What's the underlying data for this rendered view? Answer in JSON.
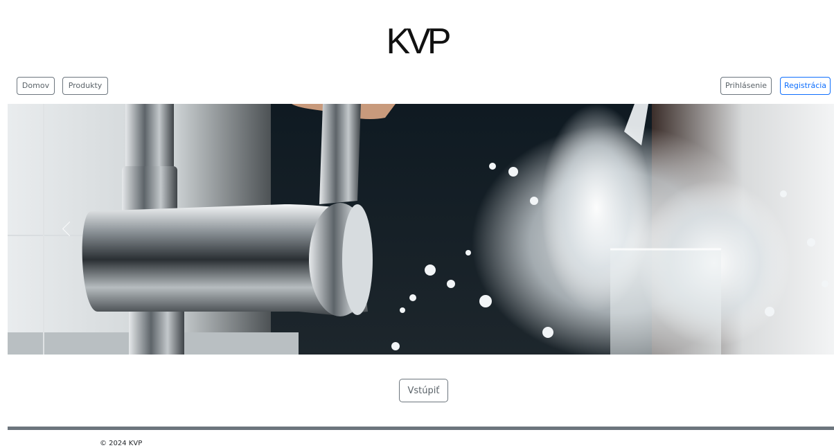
{
  "header": {
    "logo": "KVP"
  },
  "nav": {
    "home_label": "Domov",
    "products_label": "Produkty",
    "login_label": "Prihlásenie",
    "register_label": "Registrácia"
  },
  "carousel": {
    "image_icon": "hero-image-faucet-water-splash"
  },
  "main": {
    "enter_label": "Vstúpiť"
  },
  "footer": {
    "copyright": "© 2024 KVP"
  },
  "colors": {
    "primary": "#0d6efd",
    "secondary": "#6c757d",
    "footer_bar": "#6c757d"
  }
}
